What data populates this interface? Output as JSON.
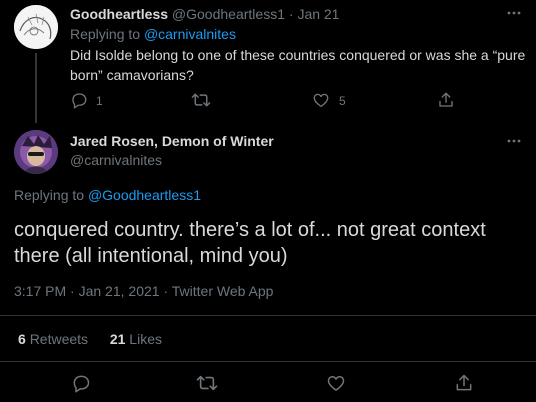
{
  "reply_tweet": {
    "display_name": "Goodheartless",
    "handle": "@Goodheartless1",
    "separator": "·",
    "date": "Jan 21",
    "replying_to_prefix": "Replying to",
    "replying_to_handle": "@carnivalnites",
    "text_line1": "Did Isolde belong to one of these countries conquered or was she a “pure",
    "text_line2": "born” camavorians?",
    "reply_count": "1",
    "retweet_count": "",
    "like_count": "5",
    "more_icon": "more-dots-icon"
  },
  "main_tweet": {
    "display_name": "Jared Rosen, Demon of Winter",
    "handle": "@carnivalnites",
    "replying_to_prefix": "Replying to",
    "replying_to_handle": "@Goodheartless1",
    "text_line1": "conquered country. there’s a lot of... not great context",
    "text_line2": "there (all intentional, mind you)",
    "time": "3:17 PM",
    "separator1": "·",
    "date": "Jan 21, 2021",
    "separator2": "·",
    "source": "Twitter Web App",
    "retweets_value": "6",
    "retweets_label": "Retweets",
    "likes_value": "21",
    "likes_label": "Likes"
  },
  "colors": {
    "background": "#000000",
    "text": "#d9d9d9",
    "muted": "#6e767d",
    "link": "#1d9bf0",
    "divider": "#2f3336"
  }
}
